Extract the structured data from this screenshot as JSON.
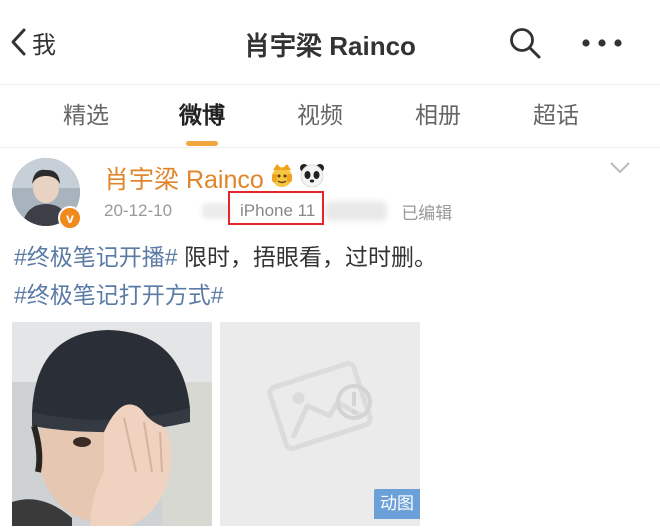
{
  "header": {
    "back_label": "我",
    "title": "肖宇梁 Rainco"
  },
  "tabs": [
    {
      "label": "精选",
      "active": false
    },
    {
      "label": "微博",
      "active": true
    },
    {
      "label": "视频",
      "active": false
    },
    {
      "label": "相册",
      "active": false
    },
    {
      "label": "超话",
      "active": false
    }
  ],
  "post": {
    "username": "肖宇梁 Rainco",
    "user_emojis": [
      "crown-face-emoji",
      "panda-emoji"
    ],
    "date": "20-12-10",
    "device": "iPhone 11",
    "edited_label": "已编辑",
    "text_line1_topic": "#终极笔记开播#",
    "text_line1_rest": " 限时，捂眼看，过时删。",
    "text_line2_topic": "#终极笔记打开方式#",
    "images": [
      {
        "kind": "photo"
      },
      {
        "kind": "placeholder",
        "badge": "动图"
      }
    ]
  },
  "colors": {
    "accent": "#f2a640",
    "username": "#e0852a",
    "topic": "#5b7ba6",
    "highlight_box": "#e4262b",
    "gif_badge": "#6ca0d8"
  }
}
